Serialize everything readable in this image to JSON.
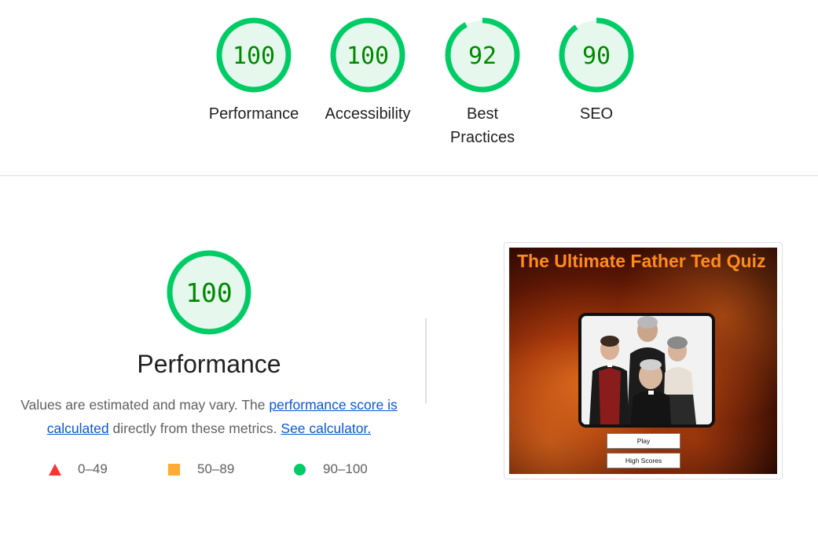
{
  "summary_scores": [
    {
      "score": "100",
      "label": "Performance",
      "value": 100
    },
    {
      "score": "100",
      "label": "Accessibility",
      "value": 100
    },
    {
      "score": "92",
      "label": "Best Practices",
      "value": 92
    },
    {
      "score": "90",
      "label": "SEO",
      "value": 90
    }
  ],
  "performance": {
    "score": "100",
    "title": "Performance",
    "desc_prefix": "Values are estimated and may vary. The ",
    "link_score": "performance score is calculated",
    "desc_middle": " directly from these metrics. ",
    "link_calc": "See calculator.",
    "legend": [
      {
        "range": "0–49",
        "shape": "triangle",
        "color": "#ff3333"
      },
      {
        "range": "50–89",
        "shape": "square",
        "color": "#ffaa33"
      },
      {
        "range": "90–100",
        "shape": "circle",
        "color": "#00cc66"
      }
    ]
  },
  "screenshot": {
    "title": "The Ultimate Father Ted Quiz",
    "play_label": "Play",
    "highscores_label": "High Scores"
  },
  "colors": {
    "gauge_ring": "#00cc66",
    "gauge_fill": "#e6f8ee",
    "gauge_text": "#008800",
    "link": "#0b57d0"
  }
}
